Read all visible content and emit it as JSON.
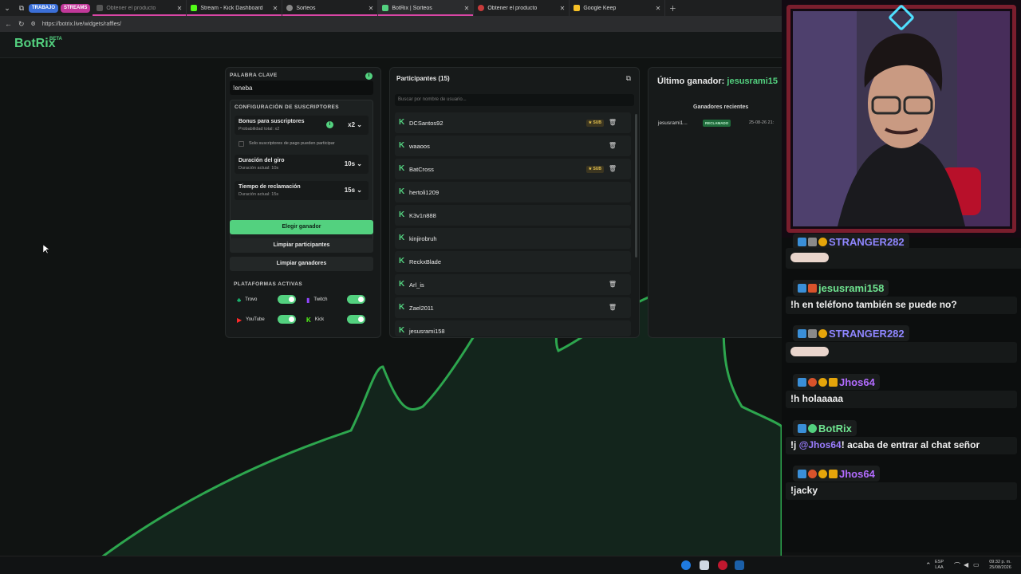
{
  "browser": {
    "tab_groups": [
      {
        "label": "TRABAJO",
        "color": "#3b6fd8"
      },
      {
        "label": "STREAMS",
        "color": "#c2389a"
      }
    ],
    "tabs": [
      {
        "title": "Obtener el producto",
        "state": "dim"
      },
      {
        "title": "Stream - Kick Dashboard",
        "state": "normal"
      },
      {
        "title": "Sorteos",
        "state": "normal"
      },
      {
        "title": "BotRix | Sorteos",
        "state": "active"
      },
      {
        "title": "Obtener el producto",
        "state": "normal"
      },
      {
        "title": "Google Keep",
        "state": "normal"
      }
    ],
    "url": "https://botrix.live/widgets/raffles/"
  },
  "site": {
    "logo": "BotRix",
    "logo_badge": "BETA"
  },
  "keyword_panel": {
    "label": "PALABRA CLAVE",
    "keyword": "!eneba",
    "sub_config_label": "CONFIGURACIÓN DE SUSCRIPTORES",
    "bonus_title": "Bonus para suscriptores",
    "bonus_sub": "Probabilidad total: x2",
    "bonus_value": "x2",
    "paid_only_label": "Solo suscriptores de pago pueden participar",
    "spin_title": "Duración del giro",
    "spin_sub": "Duración actual: 10s",
    "spin_value": "10s",
    "claim_title": "Tiempo de reclamación",
    "claim_sub": "Duración actual: 15s",
    "claim_value": "15s",
    "choose_winner": "Elegir ganador",
    "clear_participants": "Limpiar participantes",
    "clear_winners": "Limpiar ganadores",
    "platforms_label": "PLATAFORMAS ACTIVAS",
    "platforms": [
      {
        "name": "Trovo",
        "enabled": true
      },
      {
        "name": "Twitch",
        "enabled": true
      },
      {
        "name": "YouTube",
        "enabled": true
      },
      {
        "name": "Kick",
        "enabled": true
      }
    ]
  },
  "participants_panel": {
    "title": "Participantes (15)",
    "search_placeholder": "Buscar por nombre de usuario...",
    "sub_badge": "SUB",
    "rows": [
      {
        "name": "DCSantos92",
        "sub": true
      },
      {
        "name": "waaoos",
        "sub": false
      },
      {
        "name": "BatCross",
        "sub": true
      },
      {
        "name": "hertoli1209",
        "sub": false
      },
      {
        "name": "K3v1n888",
        "sub": false
      },
      {
        "name": "kinjirobruh",
        "sub": false
      },
      {
        "name": "ReckxBlade",
        "sub": false
      },
      {
        "name": "Arl_is",
        "sub": false
      },
      {
        "name": "Zael2011",
        "sub": false
      },
      {
        "name": "jesusrami158",
        "sub": false
      }
    ]
  },
  "winner_panel": {
    "title_prefix": "Último ganador:",
    "winner": "jesusrami15",
    "recent_label": "Ganadores recientes",
    "recent": [
      {
        "name": "jesusrami1...",
        "status": "RECLAMADO",
        "date": "25-08-26 21:"
      }
    ]
  },
  "chat": [
    {
      "user": "STRANGER282",
      "color": "#8f86ff",
      "message": "",
      "emote": true
    },
    {
      "user": "jesusrami158",
      "color": "#6ee38f",
      "message": "!h en teléfono también se puede no?",
      "emote": false
    },
    {
      "user": "STRANGER282",
      "color": "#8f86ff",
      "message": "",
      "emote": true
    },
    {
      "user": "Jhos64",
      "color": "#b36cff",
      "message": "!h holaaaaa",
      "emote": false
    },
    {
      "user": "BotRix",
      "color": "#6ee38f",
      "message_prefix": "!j ",
      "mention": "@Jhos64",
      "message": "! acaba de entrar al chat señor",
      "emote": false
    },
    {
      "user": "Jhos64",
      "color": "#b36cff",
      "message": "!jacky",
      "emote": false
    }
  ],
  "taskbar": {
    "lang": "ESP",
    "lang_sub": "LAA",
    "time": "09:32 p. m.",
    "date": "25/08/2026"
  },
  "colors": {
    "accent": "#53d17f",
    "brand": "#53d17f",
    "frame": "#7a1e2d"
  }
}
